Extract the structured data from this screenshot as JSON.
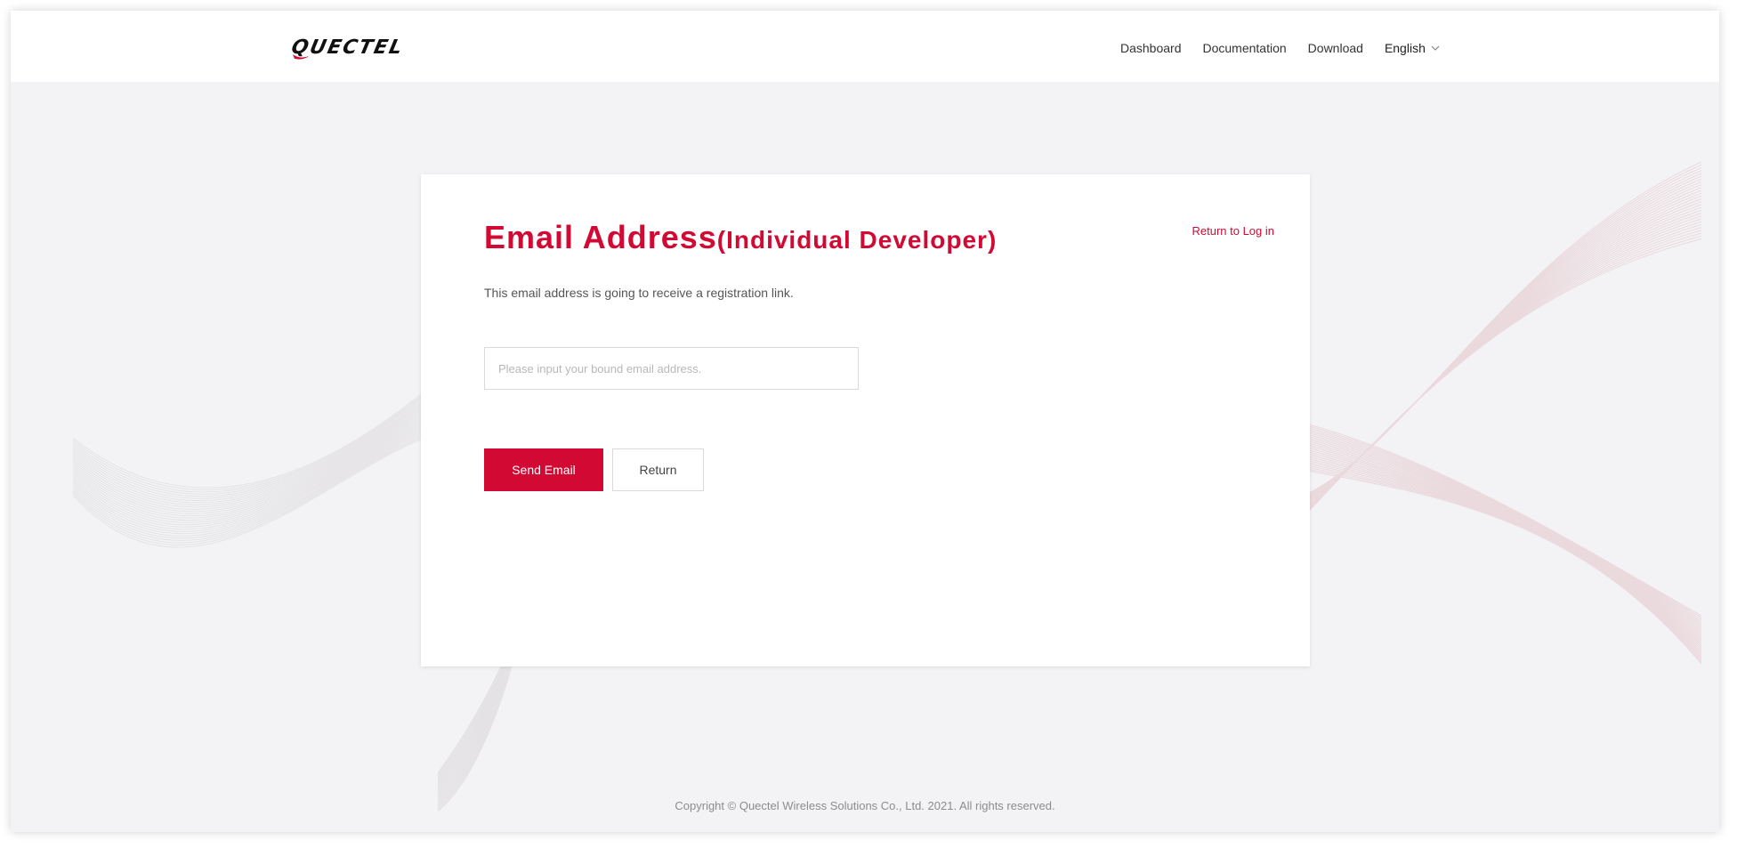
{
  "brand": {
    "logo_text": "QUECTEL",
    "accent_color": "#d20a33"
  },
  "nav": {
    "items": [
      "Dashboard",
      "Documentation",
      "Download"
    ],
    "language": "English",
    "language_icon": "chevron-down-icon"
  },
  "card": {
    "title_main": "Email Address",
    "title_sub": "(Individual Developer)",
    "return_login": "Return to Log in",
    "description": "This email address is going to receive a registration link.",
    "email_placeholder": "Please input your bound email address.",
    "email_value": "",
    "send_button": "Send Email",
    "return_button": "Return"
  },
  "footer": {
    "copyright": "Copyright © Quectel Wireless Solutions Co., Ltd. 2021. All rights reserved."
  }
}
